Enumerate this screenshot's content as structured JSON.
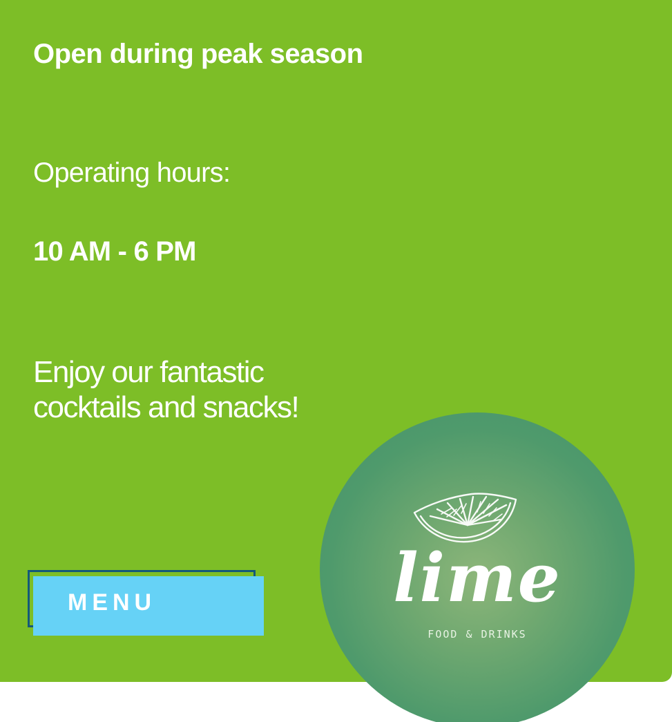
{
  "card": {
    "background": "#7dbe27",
    "heading": "Open during peak season",
    "hours_label": "Operating hours:",
    "hours_value": "10 AM - 6 PM",
    "tagline": "Enjoy our fantastic cocktails and snacks!"
  },
  "menu_button": {
    "label": "MENU",
    "color": "#66d2f6",
    "outline_color": "#14597a"
  },
  "logo": {
    "icon": "lime-slice-icon",
    "name": "lime",
    "subtitle": "FOOD & DRINKS",
    "color": "#4f9a6c"
  }
}
